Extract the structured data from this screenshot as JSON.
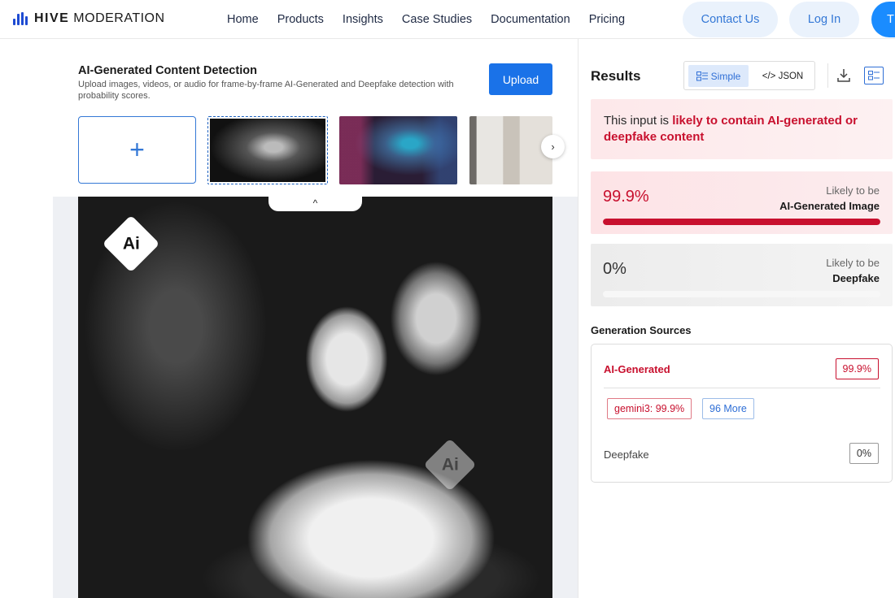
{
  "brand": {
    "name_bold": "HIVE",
    "name_rest": " MODERATION",
    "accent": "#1e4bd2"
  },
  "nav": {
    "links": [
      "Home",
      "Products",
      "Insights",
      "Case Studies",
      "Documentation",
      "Pricing"
    ],
    "contact": "Contact Us",
    "login": "Log In",
    "trial": "T"
  },
  "detection": {
    "title": "AI-Generated Content Detection",
    "description": "Upload images, videos, or audio for frame-by-frame AI-Generated and Deepfake detection with probability scores.",
    "upload": "Upload",
    "add_icon": "+",
    "next_icon": "›",
    "collapse_icon": "^"
  },
  "badges": {
    "ai_text": "Ai"
  },
  "results": {
    "title": "Results",
    "view_simple": "Simple",
    "view_json": "</> JSON",
    "verdict_prefix": "This input is ",
    "verdict_strong": "likely to contain AI-generated or deepfake content",
    "ai": {
      "pct": "99.9%",
      "likely": "Likely to be",
      "type": "AI-Generated Image",
      "fraction": 0.999,
      "color": "#c8102e"
    },
    "deepfake": {
      "pct": "0%",
      "likely": "Likely to be",
      "type": "Deepfake",
      "fraction": 0.0
    }
  },
  "sources": {
    "title": "Generation Sources",
    "ai_label": "AI-Generated",
    "ai_value": "99.9%",
    "chip_model": "gemini3: 99.9%",
    "chip_more": "96 More",
    "deepfake_label": "Deepfake",
    "deepfake_value": "0%"
  }
}
